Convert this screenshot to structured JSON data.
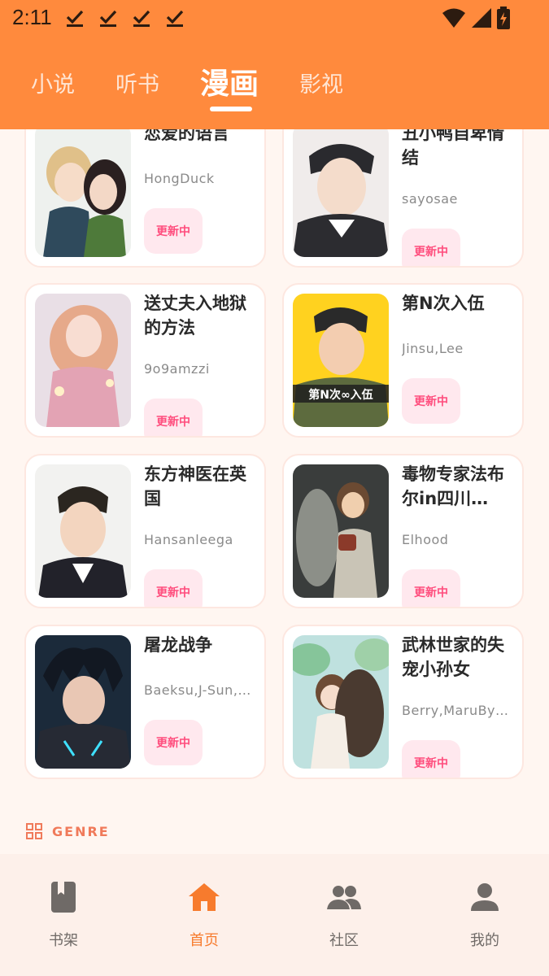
{
  "status_bar": {
    "time": "2:11"
  },
  "top_tabs": [
    {
      "label": "小说",
      "active": false
    },
    {
      "label": "听书",
      "active": false
    },
    {
      "label": "漫画",
      "active": true
    },
    {
      "label": "影视",
      "active": false
    }
  ],
  "cards": [
    {
      "title": "恋爱的语言",
      "author": "HongDuck",
      "badge": "更新中"
    },
    {
      "title": "丑小鸭自卑情结",
      "author": "sayosae",
      "badge": "更新中"
    },
    {
      "title": "送丈夫入地狱的方法",
      "author": "9o9amzzi",
      "badge": "更新中"
    },
    {
      "title": "第N次入伍",
      "author": "Jinsu,Lee",
      "badge": "更新中"
    },
    {
      "title": "东方神医在英国",
      "author": "Hansanleega",
      "badge": "更新中"
    },
    {
      "title": "毒物专家法布尔in四川…",
      "author": "Elhood",
      "badge": "更新中"
    },
    {
      "title": "屠龙战争",
      "author": "Baeksu,J-Sun,…",
      "badge": "更新中"
    },
    {
      "title": "武林世家的失宠小孙女",
      "author": "Berry,MaruBye…",
      "badge": "更新中"
    }
  ],
  "genre": {
    "label": "GENRE",
    "icon": "grid-icon"
  },
  "bottom_nav": [
    {
      "label": "书架",
      "icon": "book-icon",
      "active": false
    },
    {
      "label": "首页",
      "icon": "home-icon",
      "active": true
    },
    {
      "label": "社区",
      "icon": "people-icon",
      "active": false
    },
    {
      "label": "我的",
      "icon": "person-icon",
      "active": false
    }
  ],
  "colors": {
    "header": "#ff8a3d",
    "accent": "#f77b2d",
    "badge_bg": "#ffe8ee",
    "badge_text": "#ff4d7d",
    "page_bg": "#fff6f1"
  }
}
